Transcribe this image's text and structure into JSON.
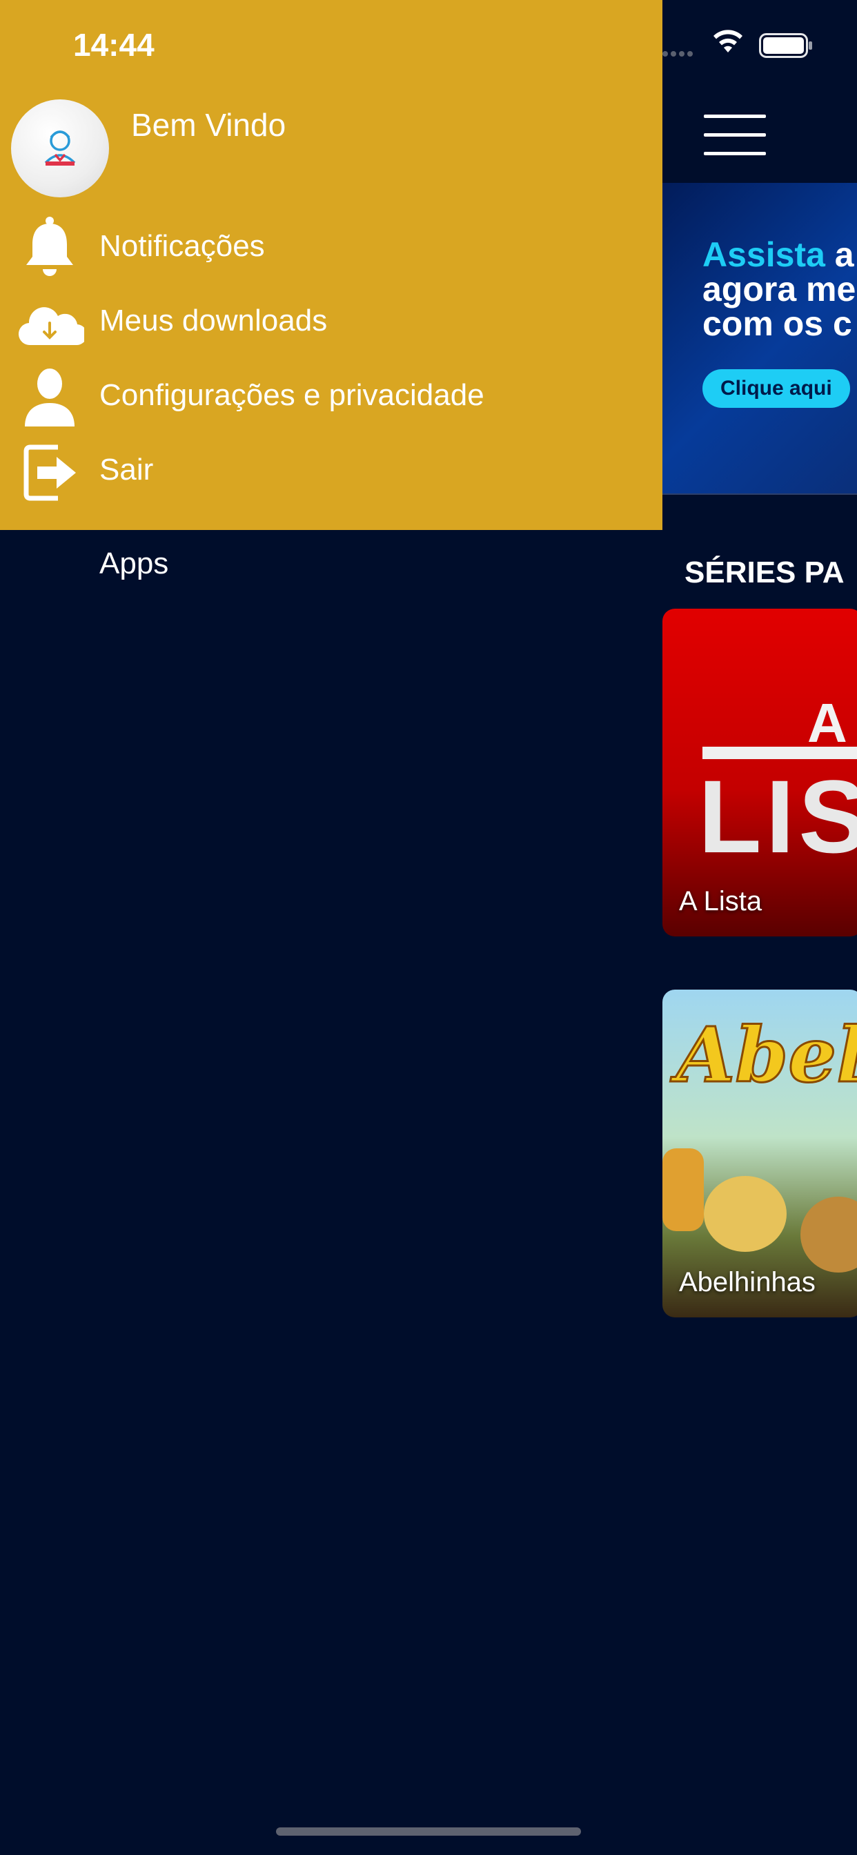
{
  "status_bar": {
    "time": "14:44"
  },
  "drawer": {
    "welcome": "Bem Vindo",
    "items": [
      {
        "label": "Notificações",
        "icon": "bell-icon"
      },
      {
        "label": "Meus downloads",
        "icon": "cloud-download-icon"
      },
      {
        "label": "Configurações e privacidade",
        "icon": "user-icon"
      },
      {
        "label": "Sair",
        "icon": "logout-icon"
      }
    ],
    "apps_label": "Apps"
  },
  "banner": {
    "line1_accent": "Assista",
    "line1_rest": " a",
    "line2": "agora me",
    "line3": "com os c",
    "cta": "Clique aqui"
  },
  "section": {
    "title": "SÉRIES PA"
  },
  "cards": [
    {
      "title": "A Lista",
      "logo_small": "A",
      "logo_big": "LIS"
    },
    {
      "title": "Abelhinhas",
      "logo": "Abelhi"
    }
  ],
  "colors": {
    "drawer_header": "#d9a622",
    "background": "#000d2b",
    "accent": "#1ecdf5",
    "card_red": "#e10000"
  }
}
